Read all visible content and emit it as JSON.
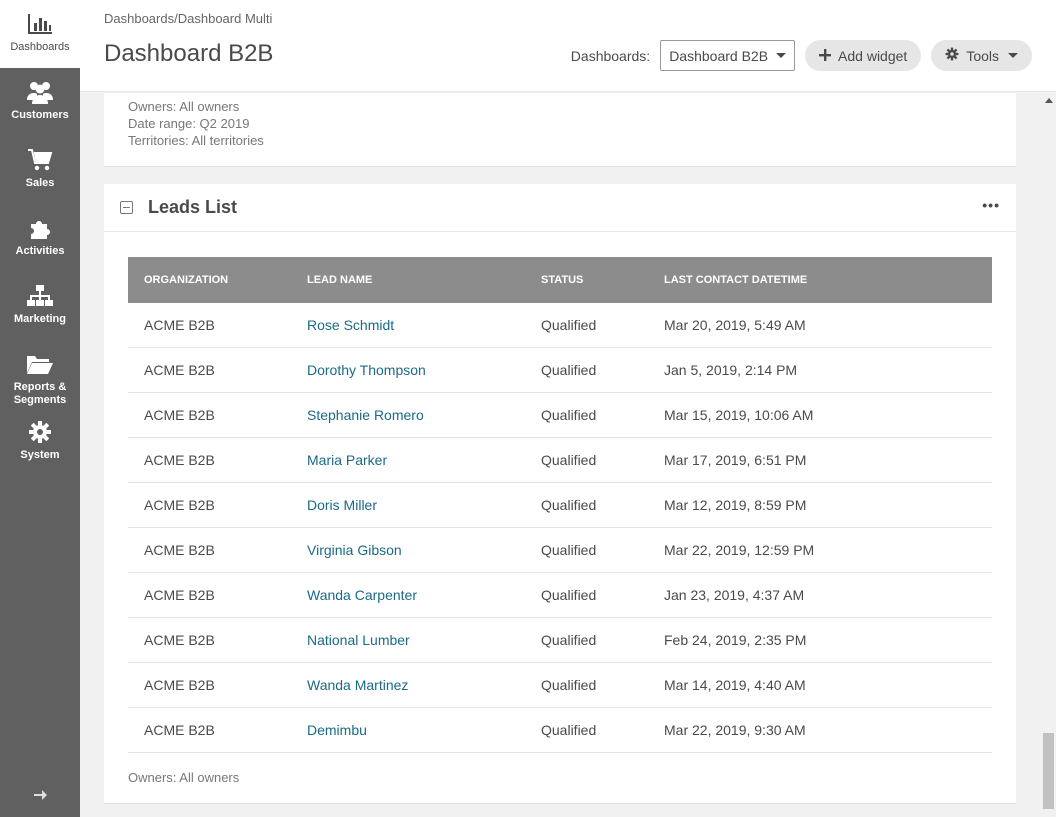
{
  "sidebar": {
    "items": [
      {
        "label": "Dashboards",
        "icon": "bar-chart-icon",
        "active": true
      },
      {
        "label": "Customers",
        "icon": "users-icon"
      },
      {
        "label": "Sales",
        "icon": "cart-icon"
      },
      {
        "label": "Activities",
        "icon": "puzzle-icon"
      },
      {
        "label": "Marketing",
        "icon": "sitemap-icon"
      },
      {
        "label": "Reports & Segments",
        "icon": "folder-icon"
      },
      {
        "label": "System",
        "icon": "gear-icon"
      }
    ],
    "expand_icon": "arrow-right-icon"
  },
  "header": {
    "breadcrumb": [
      "Dashboards",
      "Dashboard Multi"
    ],
    "breadcrumb_sep": "/",
    "title": "Dashboard B2B",
    "dashboards_label": "Dashboards:",
    "dashboard_select_value": "Dashboard B2B",
    "add_widget_label": "Add widget",
    "tools_label": "Tools"
  },
  "top_widget": {
    "owners": "Owners: All owners",
    "date_range": "Date range: Q2 2019",
    "territories": "Territories: All territories"
  },
  "leads": {
    "title": "Leads List",
    "more": "•••",
    "columns": [
      "Organization",
      "Lead Name",
      "Status",
      "Last Contact Datetime"
    ],
    "rows": [
      {
        "org": "ACME B2B",
        "name": "Rose Schmidt",
        "status": "Qualified",
        "date": "Mar 20, 2019, 5:49 AM"
      },
      {
        "org": "ACME B2B",
        "name": "Dorothy Thompson",
        "status": "Qualified",
        "date": "Jan 5, 2019, 2:14 PM"
      },
      {
        "org": "ACME B2B",
        "name": "Stephanie Romero",
        "status": "Qualified",
        "date": "Mar 15, 2019, 10:06 AM"
      },
      {
        "org": "ACME B2B",
        "name": "Maria Parker",
        "status": "Qualified",
        "date": "Mar 17, 2019, 6:51 PM"
      },
      {
        "org": "ACME B2B",
        "name": "Doris Miller",
        "status": "Qualified",
        "date": "Mar 12, 2019, 8:59 PM"
      },
      {
        "org": "ACME B2B",
        "name": "Virginia Gibson",
        "status": "Qualified",
        "date": "Mar 22, 2019, 12:59 PM"
      },
      {
        "org": "ACME B2B",
        "name": "Wanda Carpenter",
        "status": "Qualified",
        "date": "Jan 23, 2019, 4:37 AM"
      },
      {
        "org": "ACME B2B",
        "name": "National Lumber",
        "status": "Qualified",
        "date": "Feb 24, 2019, 2:35 PM"
      },
      {
        "org": "ACME B2B",
        "name": "Wanda Martinez",
        "status": "Qualified",
        "date": "Mar 14, 2019, 4:40 AM"
      },
      {
        "org": "ACME B2B",
        "name": "Demimbu",
        "status": "Qualified",
        "date": "Mar 22, 2019, 9:30 AM"
      }
    ],
    "footer": "Owners: All owners"
  },
  "colors": {
    "sidebar_bg": "#606060",
    "link": "#1b6a86",
    "table_header_bg": "#8c8c8c"
  }
}
